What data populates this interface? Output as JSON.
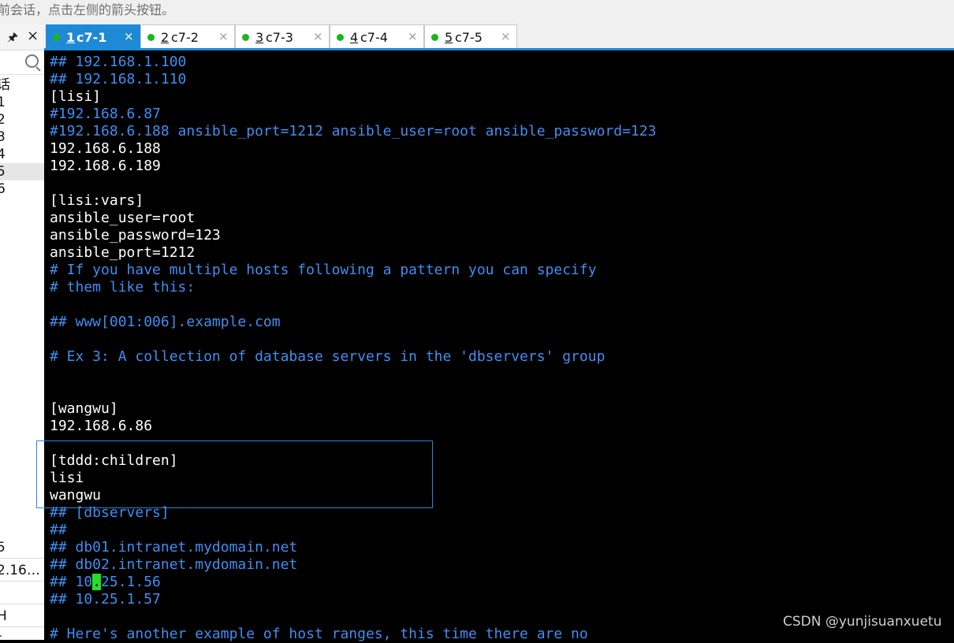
{
  "hint_bar": {
    "text": "前会话，点击左侧的箭头按钮。"
  },
  "left_panel": {
    "tree_items": [
      "话",
      "1",
      "2",
      "3",
      "4",
      "5",
      "6"
    ],
    "session_rows": [
      "5",
      "2.16…",
      "",
      "H",
      "t"
    ]
  },
  "tabs": [
    {
      "num": "1",
      "name": "c7-1",
      "active": true
    },
    {
      "num": "2",
      "name": "c7-2",
      "active": false
    },
    {
      "num": "3",
      "name": "c7-3",
      "active": false
    },
    {
      "num": "4",
      "name": "c7-4",
      "active": false
    },
    {
      "num": "5",
      "name": "c7-5",
      "active": false
    }
  ],
  "close_glyph": "×",
  "terminal_lines": [
    {
      "text": "## 192.168.1.100",
      "style": "comment"
    },
    {
      "text": "## 192.168.1.110",
      "style": "comment"
    },
    {
      "text": "[lisi]",
      "style": "plain"
    },
    {
      "text": "#192.168.6.87",
      "style": "comment"
    },
    {
      "text": "#192.168.6.188 ansible_port=1212 ansible_user=root ansible_password=123",
      "style": "comment"
    },
    {
      "text": "192.168.6.188",
      "style": "plain"
    },
    {
      "text": "192.168.6.189",
      "style": "plain"
    },
    {
      "text": "",
      "style": "plain"
    },
    {
      "text": "[lisi:vars]",
      "style": "plain"
    },
    {
      "text": "ansible_user=root",
      "style": "plain"
    },
    {
      "text": "ansible_password=123",
      "style": "plain"
    },
    {
      "text": "ansible_port=1212",
      "style": "plain"
    },
    {
      "text": "# If you have multiple hosts following a pattern you can specify",
      "style": "comment"
    },
    {
      "text": "# them like this:",
      "style": "comment"
    },
    {
      "text": "",
      "style": "plain"
    },
    {
      "text": "## www[001:006].example.com",
      "style": "comment"
    },
    {
      "text": "",
      "style": "plain"
    },
    {
      "text": "# Ex 3: A collection of database servers in the 'dbservers' group",
      "style": "comment"
    },
    {
      "text": "",
      "style": "plain"
    },
    {
      "text": "",
      "style": "plain"
    },
    {
      "text": "[wangwu]",
      "style": "plain"
    },
    {
      "text": "192.168.6.86",
      "style": "plain"
    },
    {
      "text": "",
      "style": "plain"
    },
    {
      "text": "[tddd:children]",
      "style": "plain"
    },
    {
      "text": "lisi",
      "style": "plain"
    },
    {
      "text": "wangwu",
      "style": "plain"
    },
    {
      "text": "## [dbservers]",
      "style": "comment"
    },
    {
      "text": "##",
      "style": "comment"
    },
    {
      "text": "## db01.intranet.mydomain.net",
      "style": "comment"
    },
    {
      "text": "## db02.intranet.mydomain.net",
      "style": "comment"
    },
    {
      "text": "## 10.25.1.56",
      "style": "comment"
    },
    {
      "text": "## 10.25.1.57",
      "style": "comment"
    },
    {
      "text": "",
      "style": "plain"
    },
    {
      "text": "# Here's another example of host ranges, this time there are no",
      "style": "comment"
    }
  ],
  "cursor": {
    "line": 30,
    "column": 5
  },
  "watermark": "CSDN @yunjisuanxuetu"
}
